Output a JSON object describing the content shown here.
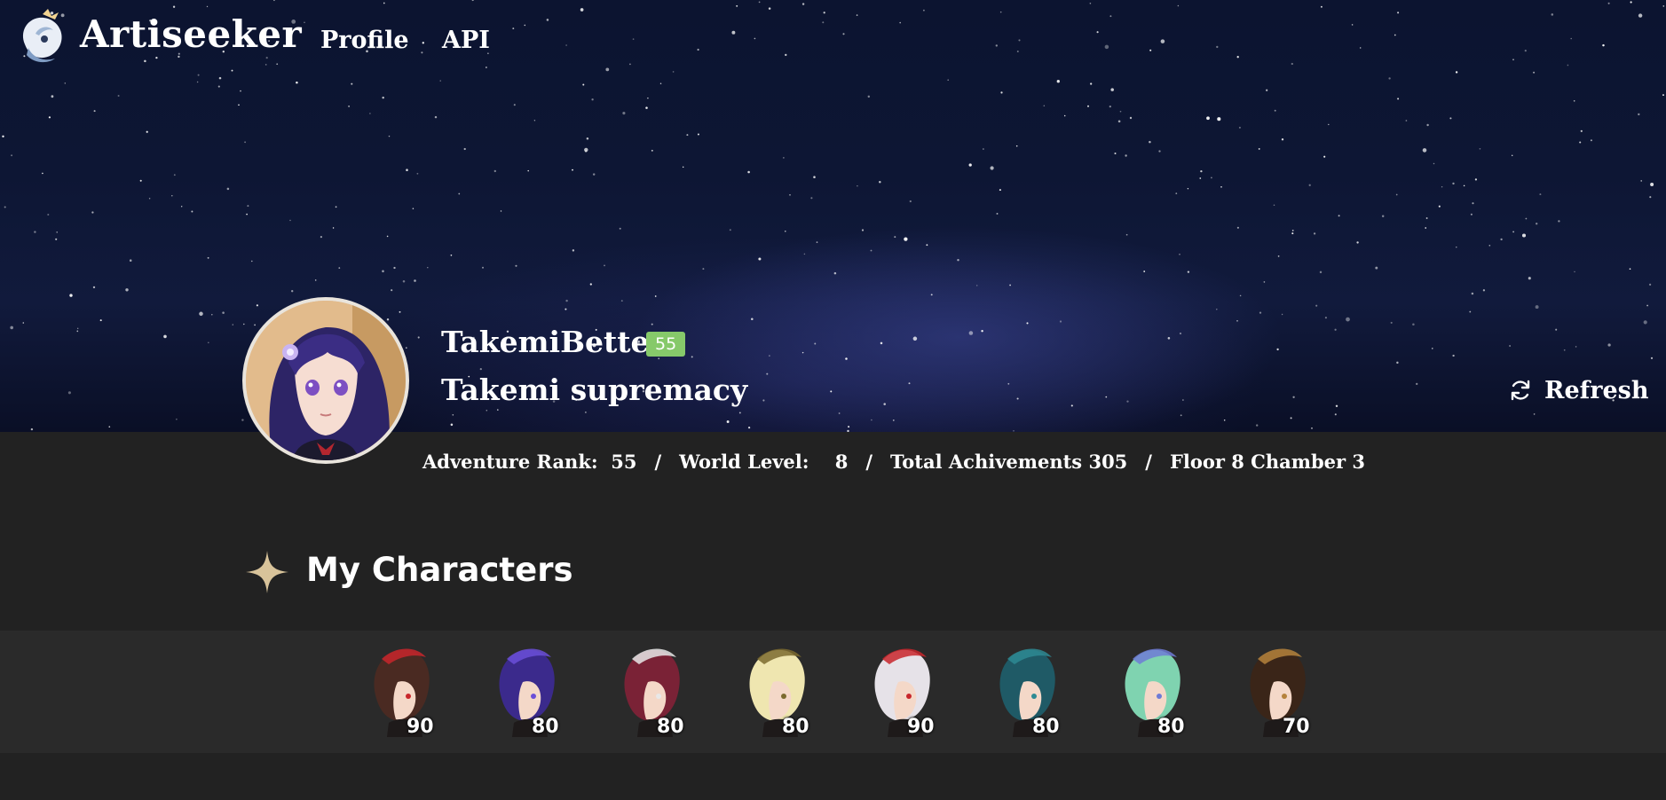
{
  "nav": {
    "brand": "Artiseeker",
    "links": [
      {
        "label": "Profile"
      },
      {
        "label": "API"
      }
    ]
  },
  "profile": {
    "username": "TakemiBetter",
    "level_badge": "55",
    "signature": "Takemi supremacy",
    "refresh_label": "Refresh"
  },
  "stats": {
    "adventure_rank_label": "Adventure Rank:",
    "adventure_rank": "55",
    "world_level_label": "World Level:",
    "world_level": "8",
    "achievements_label": "Total Achivements",
    "achievements": "305",
    "abyss": "Floor 8 Chamber 3",
    "separator": "/"
  },
  "section": {
    "title": "My Characters"
  },
  "characters": [
    {
      "level": "90",
      "hair": "#4a2a22",
      "accent": "#c8262b"
    },
    {
      "level": "80",
      "hair": "#3b2a8c",
      "accent": "#6b4fd8"
    },
    {
      "level": "80",
      "hair": "#7a2236",
      "accent": "#e8e8e8"
    },
    {
      "level": "80",
      "hair": "#efe6b0",
      "accent": "#7b6a2f"
    },
    {
      "level": "90",
      "hair": "#e6e2e8",
      "accent": "#c8262b"
    },
    {
      "level": "80",
      "hair": "#1f5a66",
      "accent": "#2e8a93"
    },
    {
      "level": "80",
      "hair": "#7fd3b0",
      "accent": "#6e7bd6"
    },
    {
      "level": "70",
      "hair": "#3a2518",
      "accent": "#b5823c"
    }
  ],
  "colors": {
    "badge": "#86c96a",
    "page_bg": "#222222",
    "strip_bg": "#2a2a2a",
    "sparkle": "#d8c39a"
  },
  "icons": {
    "logo": "paimon-logo-icon",
    "refresh": "refresh-icon",
    "section": "sparkle-star-icon"
  }
}
